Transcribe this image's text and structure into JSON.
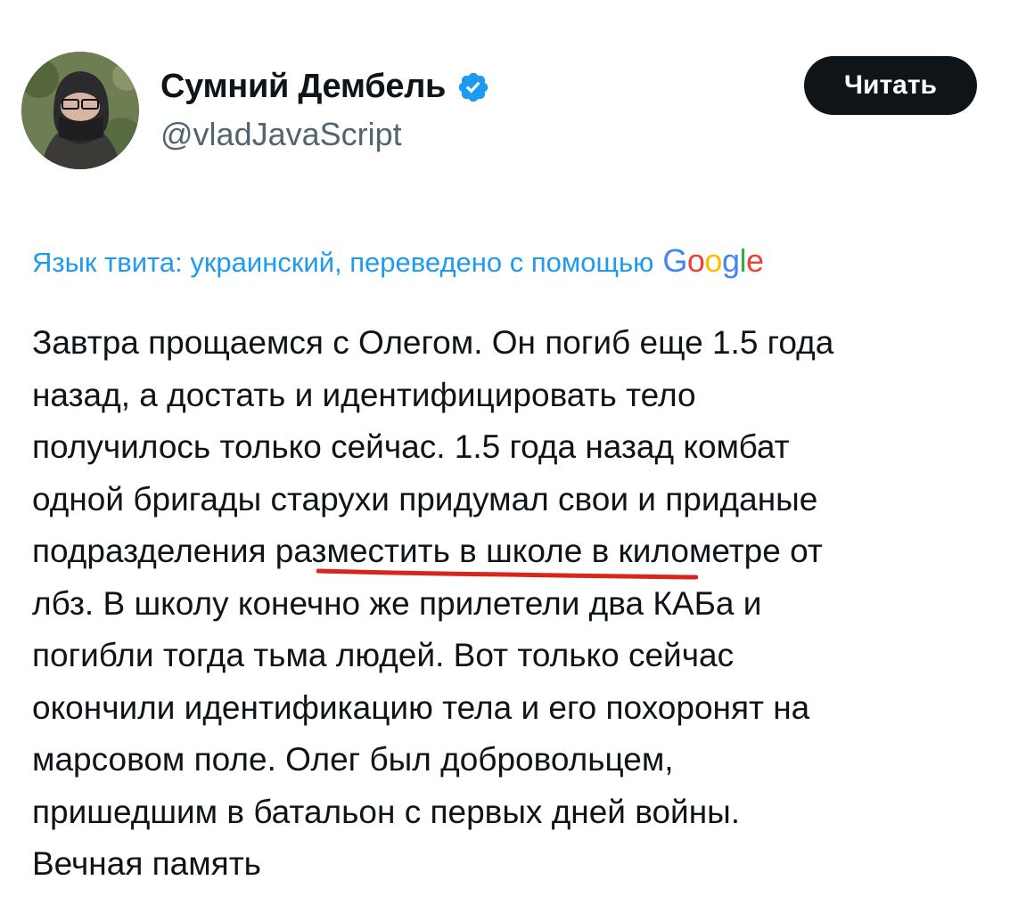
{
  "author": {
    "display_name": "Сумний Дембель",
    "handle": "@vladJavaScript",
    "verified_icon": "verified-badge-icon",
    "verified_color": "#1d9bf0"
  },
  "follow_button": {
    "label": "Читать"
  },
  "translation": {
    "note": "Язык твита: украинский, переведено с помощью",
    "provider_letters": [
      "G",
      "o",
      "o",
      "g",
      "l",
      "e"
    ],
    "note_color": "#1d9bf0"
  },
  "tweet": {
    "lines": [
      "Завтра прощаемся с Олегом. Он погиб еще 1.5 года",
      "назад, а достать и идентифицировать тело",
      "получилось только сейчас. 1.5 года назад комбат",
      "одной бригады старухи придумал свои и приданые",
      "подразделения разместить в школе в километре от",
      "лбз. В школу конечно же прилетели два КАБа и",
      "погибли тогда тьма людей. Вот только сейчас",
      "окончили идентификацию тела и его похоронят на",
      "марсовом поле. Олег был добровольцем,",
      "пришедшим в батальон с первых дней войны.",
      "Вечная память"
    ],
    "highlighted_phrase": "разместить в школе",
    "highlight_color": "#d9261c"
  },
  "colors": {
    "text": "#0f1419",
    "secondary_text": "#536471",
    "button_bg": "#0f1419",
    "button_text": "#ffffff"
  }
}
